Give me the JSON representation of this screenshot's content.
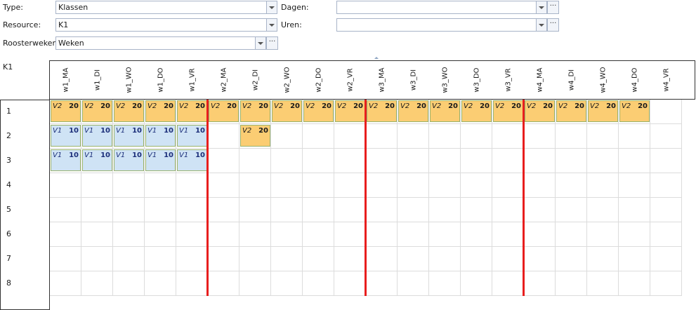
{
  "filters": {
    "type_label": "Type:",
    "type_value": "Klassen",
    "resource_label": "Resource:",
    "resource_value": "K1",
    "roosterweken_label": "Roosterweken:",
    "roosterweken_value": "Weken",
    "dagen_label": "Dagen:",
    "dagen_value": "",
    "uren_label": "Uren:",
    "uren_value": "",
    "ellipsis": "···"
  },
  "schedule": {
    "resource": "K1",
    "days": [
      "w1_MA",
      "w1_DI",
      "w1_WO",
      "w1_DO",
      "w1_VR",
      "w2_MA",
      "w2_DI",
      "w2_WO",
      "w2_DO",
      "w2_VR",
      "w3_MA",
      "w3_DI",
      "w3_WO",
      "w3_DO",
      "w3_VR",
      "w4_MA",
      "w4_DI",
      "w4_WO",
      "w4_DO",
      "w4_VR"
    ],
    "hours": [
      "1",
      "2",
      "3",
      "4",
      "5",
      "6",
      "7",
      "8"
    ],
    "week_separators_after_day": [
      4,
      9,
      14
    ],
    "lessons": [
      {
        "hour": 1,
        "day": 0,
        "code": "V2",
        "num": "20",
        "kind": "v2"
      },
      {
        "hour": 1,
        "day": 1,
        "code": "V2",
        "num": "20",
        "kind": "v2"
      },
      {
        "hour": 1,
        "day": 2,
        "code": "V2",
        "num": "20",
        "kind": "v2"
      },
      {
        "hour": 1,
        "day": 3,
        "code": "V2",
        "num": "20",
        "kind": "v2"
      },
      {
        "hour": 1,
        "day": 4,
        "code": "V2",
        "num": "20",
        "kind": "v2"
      },
      {
        "hour": 1,
        "day": 5,
        "code": "V2",
        "num": "20",
        "kind": "v2"
      },
      {
        "hour": 1,
        "day": 6,
        "code": "V2",
        "num": "20",
        "kind": "v2"
      },
      {
        "hour": 1,
        "day": 7,
        "code": "V2",
        "num": "20",
        "kind": "v2"
      },
      {
        "hour": 1,
        "day": 8,
        "code": "V2",
        "num": "20",
        "kind": "v2"
      },
      {
        "hour": 1,
        "day": 9,
        "code": "V2",
        "num": "20",
        "kind": "v2"
      },
      {
        "hour": 1,
        "day": 10,
        "code": "V2",
        "num": "20",
        "kind": "v2"
      },
      {
        "hour": 1,
        "day": 11,
        "code": "V2",
        "num": "20",
        "kind": "v2"
      },
      {
        "hour": 1,
        "day": 12,
        "code": "V2",
        "num": "20",
        "kind": "v2"
      },
      {
        "hour": 1,
        "day": 13,
        "code": "V2",
        "num": "20",
        "kind": "v2"
      },
      {
        "hour": 1,
        "day": 14,
        "code": "V2",
        "num": "20",
        "kind": "v2"
      },
      {
        "hour": 1,
        "day": 15,
        "code": "V2",
        "num": "20",
        "kind": "v2"
      },
      {
        "hour": 1,
        "day": 16,
        "code": "V2",
        "num": "20",
        "kind": "v2"
      },
      {
        "hour": 1,
        "day": 17,
        "code": "V2",
        "num": "20",
        "kind": "v2"
      },
      {
        "hour": 1,
        "day": 18,
        "code": "V2",
        "num": "20",
        "kind": "v2"
      },
      {
        "hour": 2,
        "day": 0,
        "code": "V1",
        "num": "10",
        "kind": "v1"
      },
      {
        "hour": 2,
        "day": 1,
        "code": "V1",
        "num": "10",
        "kind": "v1"
      },
      {
        "hour": 2,
        "day": 2,
        "code": "V1",
        "num": "10",
        "kind": "v1"
      },
      {
        "hour": 2,
        "day": 3,
        "code": "V1",
        "num": "10",
        "kind": "v1"
      },
      {
        "hour": 2,
        "day": 4,
        "code": "V1",
        "num": "10",
        "kind": "v1"
      },
      {
        "hour": 2,
        "day": 6,
        "code": "V2",
        "num": "20",
        "kind": "v2"
      },
      {
        "hour": 3,
        "day": 0,
        "code": "V1",
        "num": "10",
        "kind": "v1"
      },
      {
        "hour": 3,
        "day": 1,
        "code": "V1",
        "num": "10",
        "kind": "v1"
      },
      {
        "hour": 3,
        "day": 2,
        "code": "V1",
        "num": "10",
        "kind": "v1"
      },
      {
        "hour": 3,
        "day": 3,
        "code": "V1",
        "num": "10",
        "kind": "v1"
      },
      {
        "hour": 3,
        "day": 4,
        "code": "V1",
        "num": "10",
        "kind": "v1"
      }
    ]
  },
  "colors": {
    "v2_fill": "#fbcd73",
    "v1_fill": "#cfe3f5",
    "week_separator": "#e81e1e"
  }
}
